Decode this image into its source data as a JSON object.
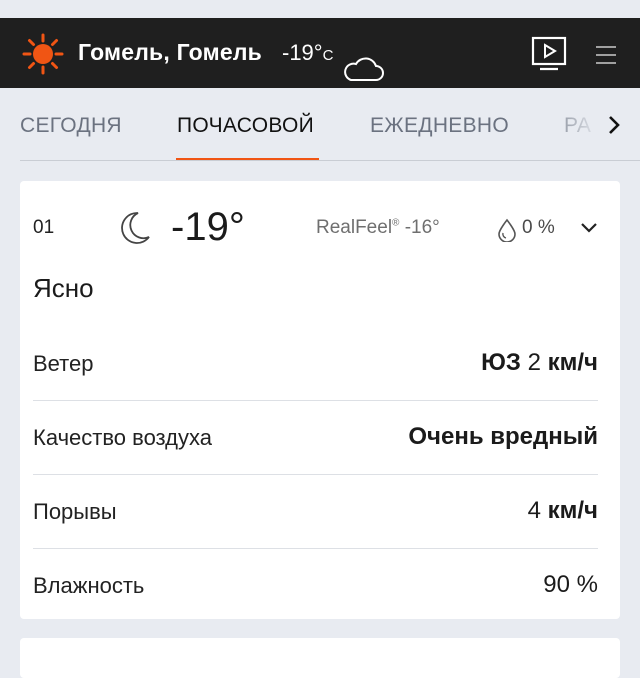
{
  "header": {
    "location": "Гомель, Гомель",
    "temperature": "-19°",
    "unit": "C",
    "weather_icon": "cloud-icon",
    "logo_icon": "sun-icon",
    "video_icon": "video-icon",
    "menu_icon": "menu-icon"
  },
  "tabs": [
    {
      "label": "СЕГОДНЯ",
      "active": false
    },
    {
      "label": "ПОЧАСОВОЙ",
      "active": true
    },
    {
      "label": "ЕЖЕДНЕВНО",
      "active": false
    },
    {
      "label": "РА",
      "active": false
    }
  ],
  "colors": {
    "accent": "#f05514",
    "header_bg": "#1f1f1f",
    "air_quality": "#a23ed0"
  },
  "card": {
    "hour": "01",
    "temperature": "-19°",
    "realfeel_label": "RealFeel",
    "realfeel_mark": "®",
    "realfeel_value": "-16°",
    "precip": "0 %",
    "condition": "Ясно",
    "details": {
      "wind": {
        "label": "Ветер",
        "dir": "ЮЗ",
        "speed": "2",
        "unit": "км/ч"
      },
      "air": {
        "label": "Качество воздуха",
        "value": "Очень вредный"
      },
      "gusts": {
        "label": "Порывы",
        "speed": "4",
        "unit": "км/ч"
      },
      "humidity": {
        "label": "Влажность",
        "value": "90 %"
      }
    }
  }
}
